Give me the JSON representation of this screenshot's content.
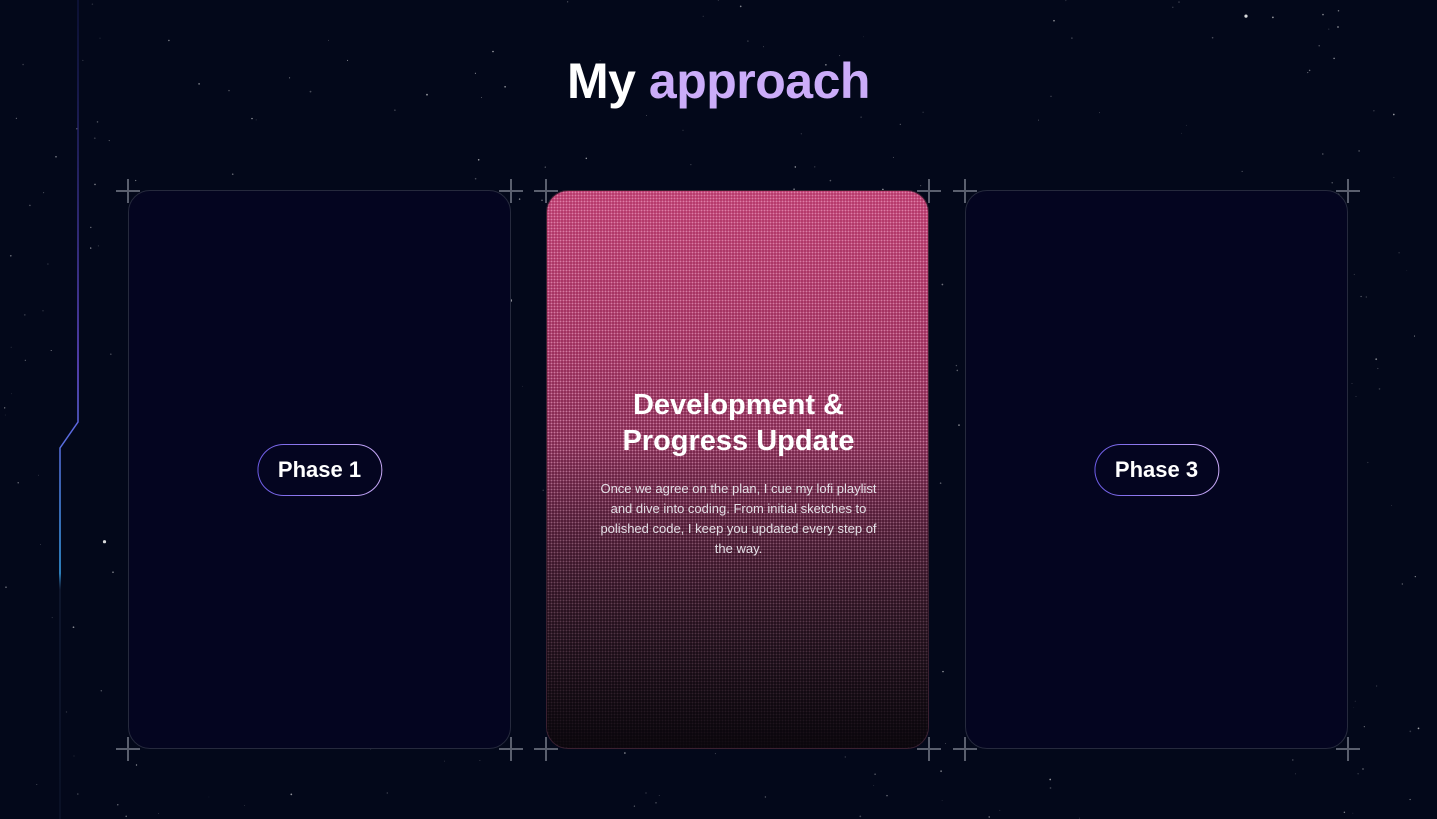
{
  "heading": {
    "prefix": "My",
    "accent": "approach"
  },
  "cards": [
    {
      "pill_label": "Phase 1"
    },
    {
      "title": "Development & Progress Update",
      "description": "Once we agree on the plan, I cue my lofi playlist and dive into coding. From initial sketches to polished code, I keep you updated every step of the way."
    },
    {
      "pill_label": "Phase 3"
    }
  ],
  "colors": {
    "background": "#03081a",
    "accent": "#cbacf9",
    "card_active_top": "#b83a6c",
    "card_border": "#262a3d"
  }
}
